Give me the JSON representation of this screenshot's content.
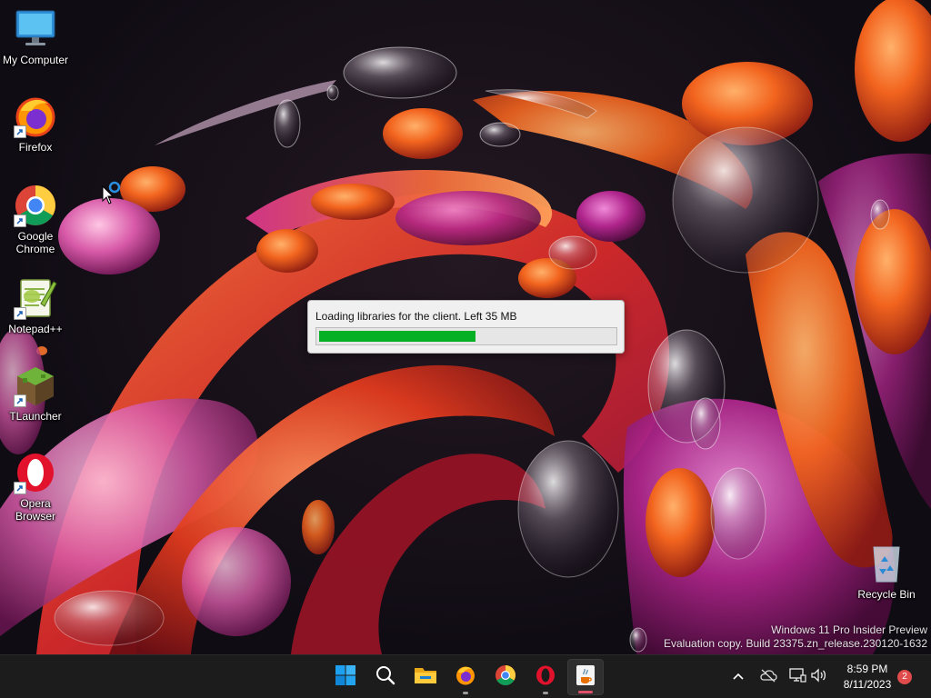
{
  "desktop": {
    "icons": [
      {
        "label": "My Computer",
        "icon": "monitor-icon"
      },
      {
        "label": "Firefox",
        "icon": "firefox-icon"
      },
      {
        "label": "Google Chrome",
        "icon": "chrome-icon"
      },
      {
        "label": "Notepad++",
        "icon": "notepadpp-icon"
      },
      {
        "label": "TLauncher",
        "icon": "tlauncher-icon"
      },
      {
        "label": "Opera Browser",
        "icon": "opera-icon"
      },
      {
        "label": "Recycle Bin",
        "icon": "recycle-bin-icon"
      }
    ]
  },
  "loader": {
    "message": "Loading libraries for the client. Left 35 MB",
    "progress": 0.53,
    "fill_color": "#06b025"
  },
  "watermark": {
    "line1": "Windows 11 Pro Insider Preview",
    "line2": "Evaluation copy. Build 23375.zn_release.230120-1632"
  },
  "taskbar": {
    "apps": [
      {
        "name": "Start",
        "icon": "windows-start-icon"
      },
      {
        "name": "Search",
        "icon": "search-icon"
      },
      {
        "name": "File Explorer",
        "icon": "folder-icon"
      },
      {
        "name": "Firefox",
        "icon": "firefox-icon"
      },
      {
        "name": "Google Chrome",
        "icon": "chrome-icon"
      },
      {
        "name": "Opera",
        "icon": "opera-icon"
      },
      {
        "name": "Java",
        "icon": "java-icon"
      }
    ],
    "clock": {
      "time": "8:59 PM",
      "date": "8/11/2023"
    },
    "notification_count": "2"
  },
  "colors": {
    "taskbar": "#1c1c1c",
    "accent": "#0078d4"
  }
}
